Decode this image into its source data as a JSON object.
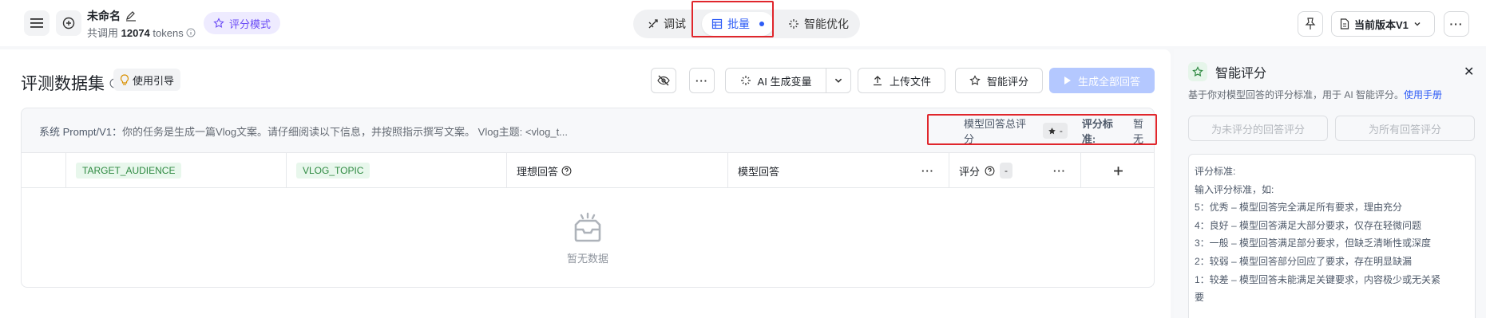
{
  "header": {
    "title": "未命名",
    "subtitle_prefix": "共调用",
    "token_count": "12074",
    "token_unit": "tokens",
    "mode_tag": "评分模式",
    "tabs": [
      {
        "label": "调试"
      },
      {
        "label": "批量"
      },
      {
        "label": "智能优化"
      }
    ],
    "version_label": "当前版本V1"
  },
  "dataset": {
    "title": "评测数据集",
    "guide_label": "使用引导",
    "toolbar": {
      "ai_generate": "AI 生成变量",
      "upload": "上传文件",
      "smart_score": "智能评分",
      "generate_all": "生成全部回答"
    },
    "prompt_label": "系统 Prompt/V1：",
    "prompt_text": "你的任务是生成一篇Vlog文案。请仔细阅读以下信息，并按照指示撰写文案。 Vlog主题: <vlog_t...",
    "score_total_label": "模型回答总评分",
    "score_chip_value": "-",
    "criteria_label": "评分标准:",
    "criteria_value": "暂无",
    "columns": {
      "var1": "TARGET_AUDIENCE",
      "var2": "VLOG_TOPIC",
      "ideal": "理想回答",
      "model": "模型回答",
      "score": "评分",
      "score_chip": "-"
    },
    "empty_text": "暂无数据"
  },
  "panel": {
    "title": "智能评分",
    "desc": "基于你对模型回答的评分标准，用于 AI 智能评分。",
    "manual_link": "使用手册",
    "btn_unscored": "为未评分的回答评分",
    "btn_all": "为所有回答评分",
    "criteria_lines": [
      "评分标准:",
      "输入评分标准，如:",
      "5：优秀 – 模型回答完全满足所有要求，理由充分",
      "4：良好 – 模型回答满足大部分要求，仅存在轻微问题",
      "3：一般 – 模型回答满足部分要求，但缺乏清晰性或深度",
      "2：较弱 – 模型回答部分回应了要求，存在明显缺漏",
      "1：较差 – 模型回答未能满足关键要求，内容极少或无关紧",
      "要"
    ]
  },
  "colors": {
    "accent": "#2e5cf6",
    "highlight_border": "#e0262c",
    "tag_green_bg": "#e8f7ec",
    "tag_green_text": "#2f8a42",
    "mode_tag_text": "#6b4cf6"
  }
}
